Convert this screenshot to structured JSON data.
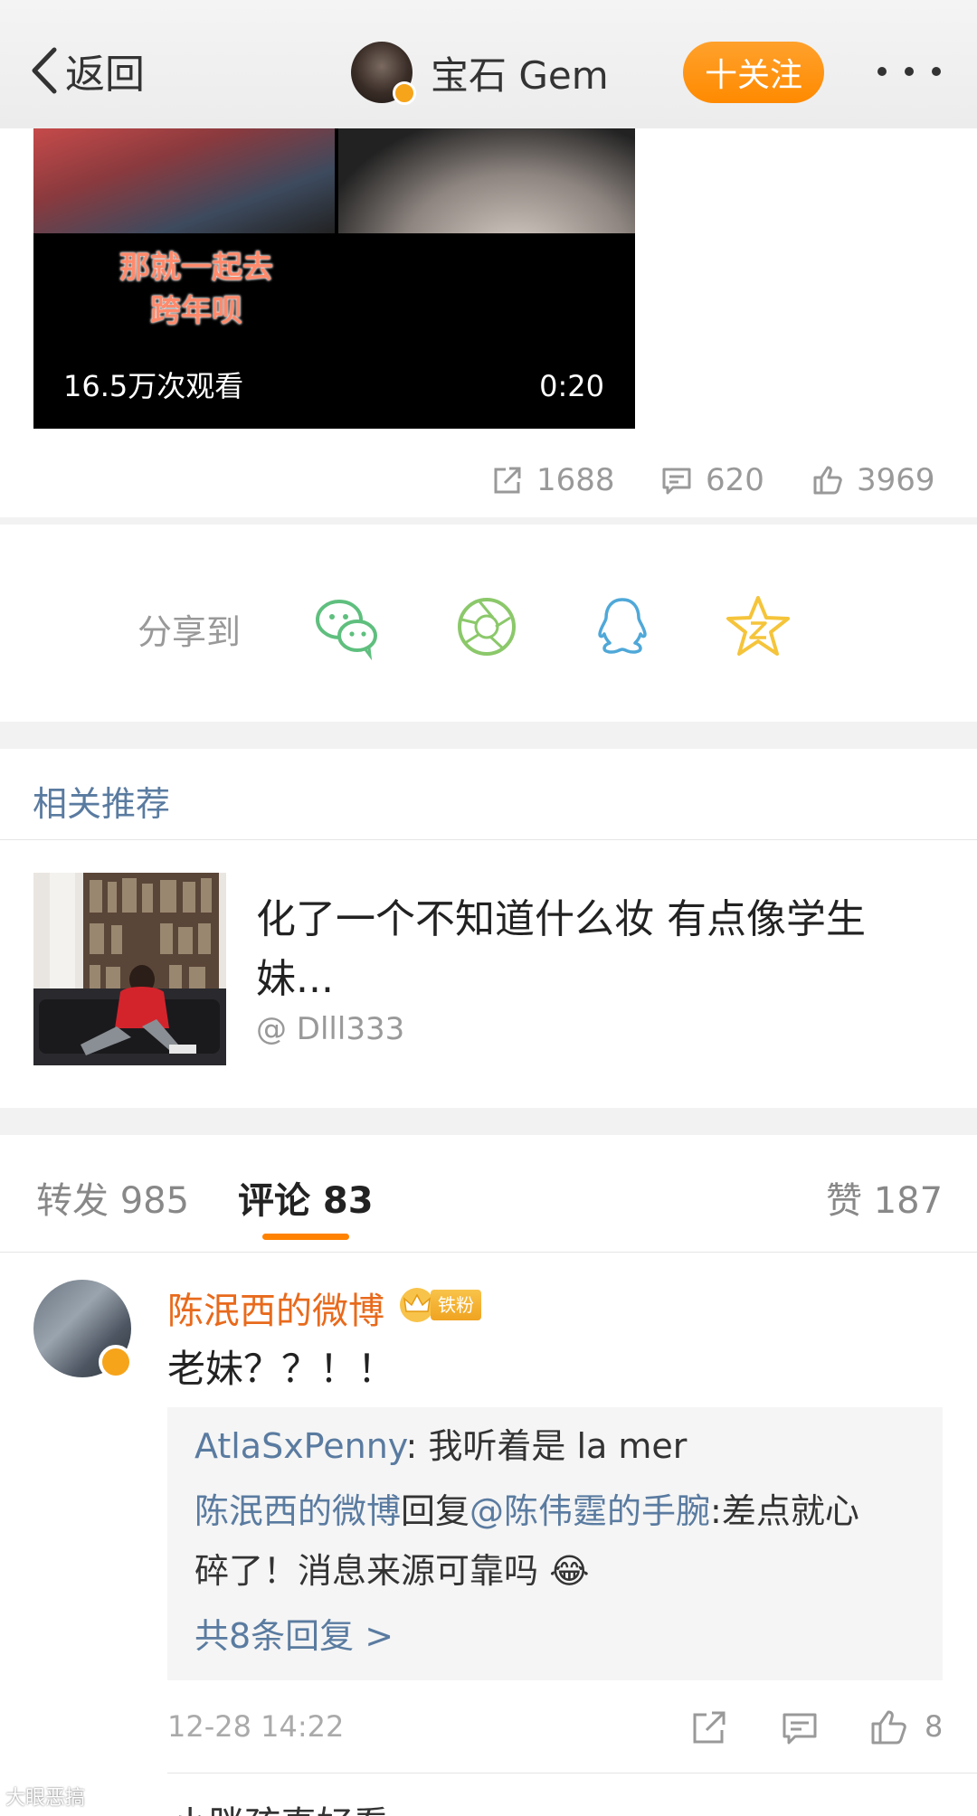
{
  "header": {
    "back_label": "返回",
    "account_name": "宝石 Gem",
    "follow_label": "十关注"
  },
  "video": {
    "caption_line1": "那就一起去",
    "caption_line2": "跨年呗",
    "views": "16.5万次观看",
    "duration": "0:20"
  },
  "stats": {
    "reposts": "1688",
    "comments": "620",
    "likes": "3969"
  },
  "share": {
    "label": "分享到",
    "targets": [
      "wechat-icon",
      "moments-icon",
      "qq-icon",
      "qzone-icon"
    ],
    "colors": {
      "wechat": "#5fbf7e",
      "moments": "#8bc86a",
      "qq": "#4fa8d8",
      "qzone": "#f5c43a"
    }
  },
  "related": {
    "section_title": "相关推荐",
    "post_text": "化了一个不知道什么妆 有点像学生妹...",
    "author": "@ Dlll333"
  },
  "tabs": {
    "repost": "转发 985",
    "comment": "评论 83",
    "like": "赞 187",
    "active_color": "#ff8200"
  },
  "comment": {
    "author": "陈泯西的微博",
    "fan_badge": "铁粉",
    "text": "老妹？？！！",
    "replies": {
      "reply1_user": "AtlaSxPenny",
      "reply1_text": ": 我听着是 la mer",
      "reply2_user": "陈泯西的微博",
      "reply2_verb": "回复",
      "reply2_mention": "@陈伟霆的手腕",
      "reply2_text_line1": ":差点就心",
      "reply2_text_line2": "碎了！消息来源可靠吗 😂",
      "more_replies": "共8条回复 >"
    },
    "time": "12-28 14:22",
    "like_count": "8"
  },
  "next_comment_hint": "小胖孩真好看",
  "watermark": "大眼恶搞"
}
